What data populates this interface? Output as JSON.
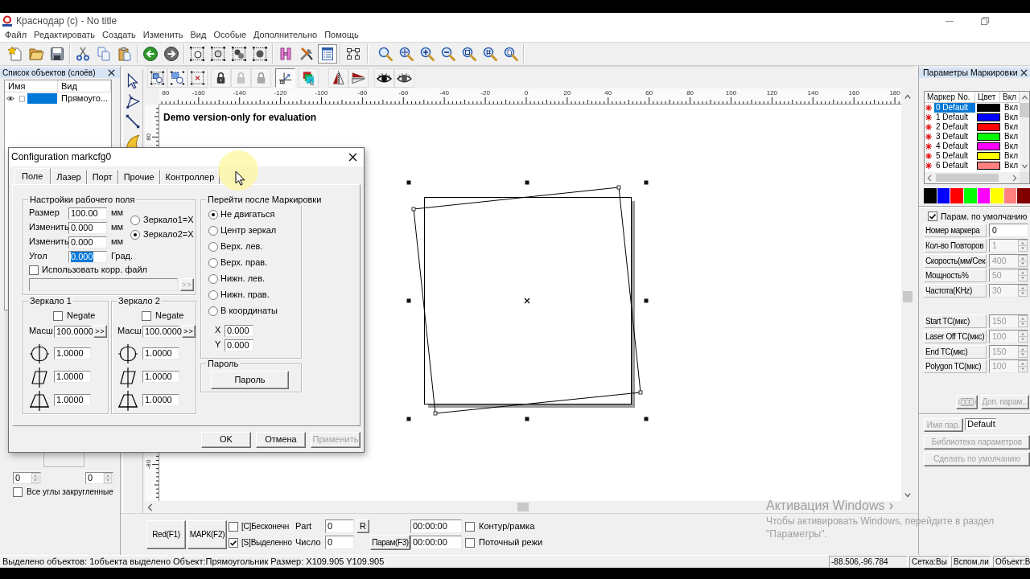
{
  "window": {
    "title": "Краснодар (с) - No title"
  },
  "menu": [
    "Файл",
    "Редактировать",
    "Создать",
    "Изменить",
    "Вид",
    "Особые",
    "Дополнительно",
    "Помощь"
  ],
  "toolbar_main": [
    {
      "pressed": false
    },
    {
      "pressed": false
    },
    {
      "pressed": false
    },
    {
      "pressed": false
    },
    {
      "pressed": false
    },
    {
      "pressed": false
    },
    {
      "pressed": false
    },
    {
      "pressed": false
    },
    {
      "pressed": false
    },
    {
      "pressed": false
    },
    {
      "pressed": false
    },
    {
      "pressed": false
    },
    {
      "pressed": false
    },
    {
      "pressed": false
    },
    {
      "pressed": true
    },
    {
      "pressed": false
    },
    {
      "pressed": false
    },
    {
      "pressed": false
    },
    {
      "pressed": false
    },
    {
      "pressed": false
    },
    {
      "pressed": false
    },
    {
      "pressed": false
    },
    {
      "pressed": false
    }
  ],
  "toolbar_objects": [
    {
      "pressed": false
    },
    {
      "pressed": false
    },
    {
      "pressed": false
    },
    {
      "pressed": false
    },
    {
      "pressed": false
    },
    {
      "pressed": false
    },
    {
      "pressed": true
    },
    {
      "pressed": false
    },
    {
      "pressed": false
    },
    {
      "pressed": false
    },
    {
      "pressed": false
    },
    {
      "pressed": false
    }
  ],
  "object_list": {
    "title": "Список объектов (слоёв)",
    "columns": [
      "Имя",
      "Вид"
    ],
    "rows": [
      {
        "selected": true,
        "checked": false,
        "type": "Прямоуго..."
      }
    ]
  },
  "properties_panel": {
    "spin_values": [
      "0",
      "0"
    ],
    "rounded_corners": {
      "label": "Все углы закругленные",
      "checked": false
    }
  },
  "canvas": {
    "notice": "Demo version-only for evaluation",
    "ruler_x_labels": [
      "80",
      "-160",
      "-140",
      "-120",
      "-100",
      "-80",
      "-60",
      "-40",
      "-20",
      "0",
      "20",
      "40",
      "60",
      "80",
      "100",
      "120",
      "140",
      "160",
      "180"
    ],
    "ruler_y_labels": [
      "80",
      "-80"
    ],
    "shape": {
      "selected": true
    }
  },
  "dialog": {
    "title": "Configuration markcfg0",
    "tabs": [
      {
        "label": "Поле",
        "selected": true
      },
      {
        "label": "Лазер",
        "selected": false
      },
      {
        "label": "Порт",
        "selected": false
      },
      {
        "label": "Прочие",
        "selected": false
      },
      {
        "label": "Контроллер",
        "selected": false
      }
    ],
    "field_settings": {
      "title": "Настройки рабочего поля",
      "rows": [
        {
          "label": "Размер",
          "value": "100.00",
          "unit": "мм",
          "text_selected": false
        },
        {
          "label": "Изменить",
          "value": "0.000",
          "unit": "мм",
          "text_selected": false
        },
        {
          "label": "Изменить",
          "value": "0.000",
          "unit": "мм",
          "text_selected": false
        },
        {
          "label": "Угол",
          "value": "0.000",
          "unit": "Град.",
          "text_selected": true
        }
      ],
      "mirror_swap": [
        {
          "label": "Зеркало1=X",
          "selected": false
        },
        {
          "label": "Зеркало2=X",
          "selected": true
        }
      ],
      "correction_file": {
        "label": "Использовать корр. файл",
        "checked": false,
        "browse": ">>",
        "disabled": true
      }
    },
    "mirrors": [
      {
        "title": "Зеркало 1",
        "negate": {
          "label": "Negate",
          "checked": false
        },
        "scale_label": "Масш",
        "scale": "100.0000",
        "scale_button": ">>",
        "factors": [
          "1.0000",
          "1.0000",
          "1.0000"
        ]
      },
      {
        "title": "Зеркало 2",
        "negate": {
          "label": "Negate",
          "checked": false
        },
        "scale_label": "Масш",
        "scale": "100.0000",
        "scale_button": ">>",
        "factors": [
          "1.0000",
          "1.0000",
          "1.0000"
        ]
      }
    ],
    "after_mark": {
      "title": "Перейти после Маркировки",
      "options": [
        {
          "label": "Не двигаться",
          "selected": true
        },
        {
          "label": "Центр зеркал",
          "selected": false
        },
        {
          "label": "Верх. лев.",
          "selected": false
        },
        {
          "label": "Верх. прав.",
          "selected": false
        },
        {
          "label": "Нижн. лев.",
          "selected": false
        },
        {
          "label": "Нижн. прав.",
          "selected": false
        },
        {
          "label": "В координаты",
          "selected": false
        }
      ],
      "coords": [
        {
          "label": "X",
          "value": "0.000"
        },
        {
          "label": "Y",
          "value": "0.000"
        }
      ]
    },
    "password": {
      "title": "Пароль",
      "button": "Пароль"
    },
    "buttons": [
      {
        "label": "OK",
        "disabled": false
      },
      {
        "label": "Отмена",
        "disabled": false
      },
      {
        "label": "Применить",
        "disabled": true
      }
    ]
  },
  "mark_params": {
    "title": "Параметры Маркировки",
    "columns": [
      "Маркер No.",
      "Цвет",
      "Вкл"
    ],
    "pens": [
      {
        "name": "0 Default",
        "color": "#000000",
        "state": "Вкл",
        "selected": true
      },
      {
        "name": "1 Default",
        "color": "#0000ff",
        "state": "Вкл",
        "selected": false
      },
      {
        "name": "2 Default",
        "color": "#ff0000",
        "state": "Вкл",
        "selected": false
      },
      {
        "name": "3 Default",
        "color": "#00ff00",
        "state": "Вкл",
        "selected": false
      },
      {
        "name": "4 Default",
        "color": "#ff00ff",
        "state": "Вкл",
        "selected": false
      },
      {
        "name": "5 Default",
        "color": "#ffff00",
        "state": "Вкл",
        "selected": false
      },
      {
        "name": "6 Default",
        "color": "#ff8080",
        "state": "Вкл",
        "selected": false
      }
    ],
    "palette": [
      {
        "color": "#000000"
      },
      {
        "color": "#0000ff"
      },
      {
        "color": "#ff0000"
      },
      {
        "color": "#00ff00"
      },
      {
        "color": "#ff00ff"
      },
      {
        "color": "#ffff00"
      },
      {
        "color": "#ff8080"
      },
      {
        "color": "#800000"
      }
    ],
    "use_default": {
      "label": "Парам. по умолчанию",
      "checked": true
    },
    "fields": [
      {
        "label": "Номер маркера",
        "value": "0",
        "kind": "text",
        "disabled": false
      },
      {
        "label": "Кол-во Повторов",
        "value": "1",
        "kind": "spin",
        "disabled": true
      },
      {
        "label": "Скорость(мм/Сек",
        "value": "400",
        "kind": "spin",
        "disabled": true
      },
      {
        "label": "Мощность%",
        "value": "50",
        "kind": "spin",
        "disabled": true
      },
      {
        "label": "Частота(KHz)",
        "value": "30",
        "kind": "spin",
        "disabled": true
      }
    ],
    "delay_fields": [
      {
        "label": "Start TC(мкс)",
        "value": "150",
        "kind": "spin",
        "disabled": true
      },
      {
        "label": "Laser Off TC(мкс)",
        "value": "100",
        "kind": "spin",
        "disabled": true
      },
      {
        "label": "End TC(мкс)",
        "value": "150",
        "kind": "spin",
        "disabled": true
      },
      {
        "label": "Polygon TC(мкс)",
        "value": "100",
        "kind": "spin",
        "disabled": true
      }
    ],
    "pattern_button": {
      "disabled": true
    },
    "more_button": {
      "label": "Доп. парам...",
      "disabled": true
    },
    "name_row": {
      "label": "Имя пар.",
      "value": "Default",
      "disabled": true
    },
    "library_button": {
      "label": "Библиотека параметров",
      "disabled": true
    },
    "default_button": {
      "label": "Сделать по умолчанию",
      "disabled": true
    }
  },
  "mark_bar": {
    "buttons": [
      "Red(F1)",
      "МАРК(F2)"
    ],
    "options": [
      {
        "label": "[C]Бесконечн",
        "checked": false
      },
      {
        "label": "[S]Выделенно",
        "checked": true
      }
    ],
    "part": {
      "label": "Part",
      "value": "0",
      "reset": "R"
    },
    "count": {
      "label": "Число",
      "value": "0"
    },
    "params_button": "Парам(F3)",
    "times": [
      "00:00:00",
      "00:00:00"
    ],
    "modes": [
      {
        "label": "Контур/рамка",
        "checked": false
      },
      {
        "label": "Поточный режи",
        "checked": false
      }
    ]
  },
  "status_bar": {
    "message": "Выделено объектов: 1объекта выделено Объект:Прямоугольник Размер: X109.905 Y109.905",
    "coords": "-88.506,-96.784",
    "panes": [
      "Сетка:Вы",
      "Вспом.ли",
      "Объект:В"
    ]
  },
  "activation_notice": {
    "title": "Активация Windows",
    "text": "Чтобы активировать Windows, перейдите в раздел \"Параметры\"."
  }
}
